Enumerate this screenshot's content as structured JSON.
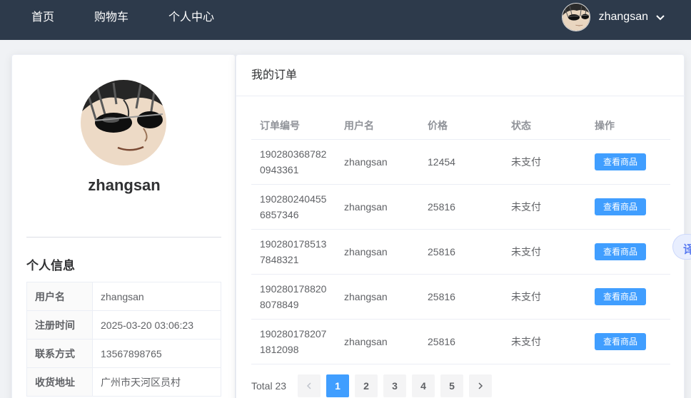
{
  "nav": {
    "items": [
      {
        "label": "首页"
      },
      {
        "label": "购物车"
      },
      {
        "label": "个人中心"
      }
    ],
    "user": {
      "name": "zhangsan",
      "avatar": "avatar-sunglasses-icon",
      "dropdown_icon": "chevron-down-icon"
    }
  },
  "profile": {
    "name": "zhangsan",
    "info_title": "个人信息",
    "fields": [
      {
        "label": "用户名",
        "value": "zhangsan"
      },
      {
        "label": "注册时间",
        "value": "2025-03-20 03:06:23"
      },
      {
        "label": "联系方式",
        "value": "13567898765"
      },
      {
        "label": "收货地址",
        "value": "广州市天河区员村"
      }
    ]
  },
  "orders": {
    "title": "我的订单",
    "columns": [
      "订单编号",
      "用户名",
      "价格",
      "状态",
      "操作"
    ],
    "rows": [
      {
        "id": "1902803687820943361",
        "user": "zhangsan",
        "price": "12454",
        "status": "未支付",
        "action": "查看商品"
      },
      {
        "id": "1902802404556857346",
        "user": "zhangsan",
        "price": "25816",
        "status": "未支付",
        "action": "查看商品"
      },
      {
        "id": "1902801785137848321",
        "user": "zhangsan",
        "price": "25816",
        "status": "未支付",
        "action": "查看商品"
      },
      {
        "id": "1902801788208078849",
        "user": "zhangsan",
        "price": "25816",
        "status": "未支付",
        "action": "查看商品"
      },
      {
        "id": "1902801782071812098",
        "user": "zhangsan",
        "price": "25816",
        "status": "未支付",
        "action": "查看商品"
      }
    ],
    "pagination": {
      "total_text": "Total 23",
      "pages": [
        "1",
        "2",
        "3",
        "4",
        "5"
      ],
      "current": "1",
      "prev_icon": "chevron-left-icon",
      "next_icon": "chevron-right-icon"
    }
  },
  "floating": {
    "translate_label": "译"
  },
  "colors": {
    "navbar": "#2d3a4b",
    "primary": "#409eff",
    "background": "#f0f2f5"
  }
}
